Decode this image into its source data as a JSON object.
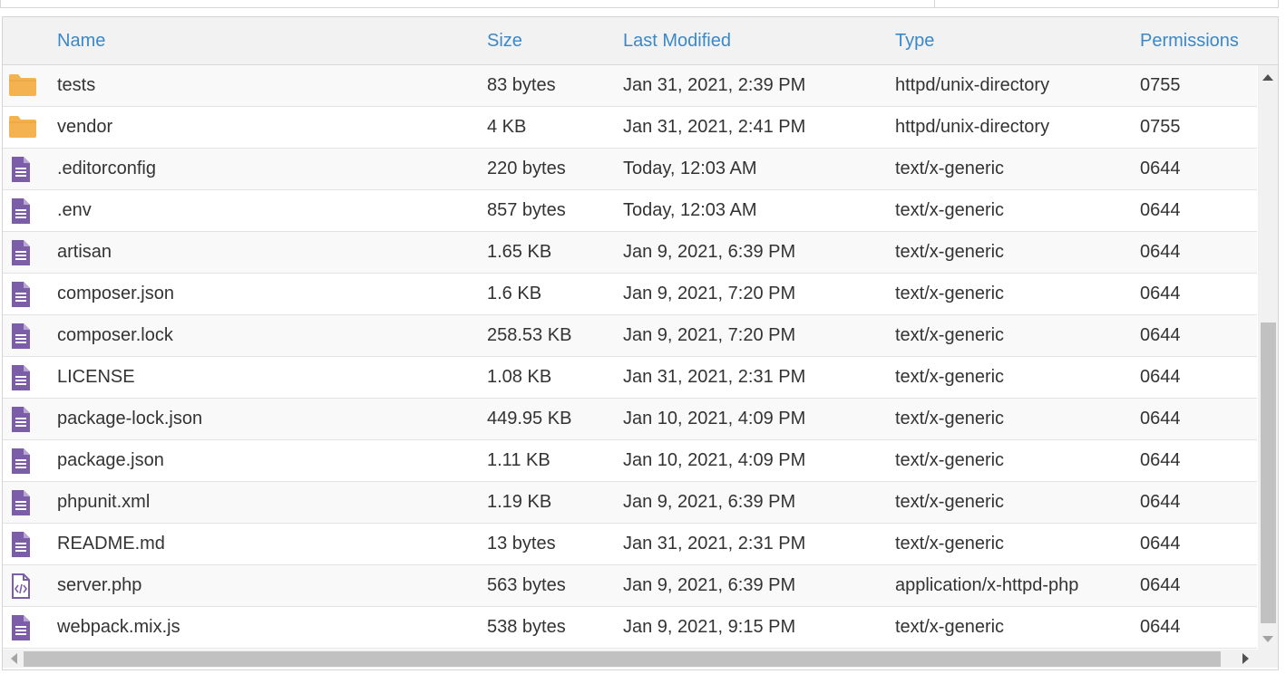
{
  "columns": {
    "name": "Name",
    "size": "Size",
    "modified": "Last Modified",
    "type": "Type",
    "permissions": "Permissions"
  },
  "colors": {
    "folder": "#f4b350",
    "file": "#7b5ea7",
    "header_text": "#3b88c8"
  },
  "rows": [
    {
      "icon": "folder-icon",
      "name": "tests",
      "size": "83 bytes",
      "modified": "Jan 31, 2021, 2:39 PM",
      "type": "httpd/unix-directory",
      "permissions": "0755"
    },
    {
      "icon": "folder-icon",
      "name": "vendor",
      "size": "4 KB",
      "modified": "Jan 31, 2021, 2:41 PM",
      "type": "httpd/unix-directory",
      "permissions": "0755"
    },
    {
      "icon": "file-text-icon",
      "name": ".editorconfig",
      "size": "220 bytes",
      "modified": "Today, 12:03 AM",
      "type": "text/x-generic",
      "permissions": "0644"
    },
    {
      "icon": "file-text-icon",
      "name": ".env",
      "size": "857 bytes",
      "modified": "Today, 12:03 AM",
      "type": "text/x-generic",
      "permissions": "0644"
    },
    {
      "icon": "file-text-icon",
      "name": "artisan",
      "size": "1.65 KB",
      "modified": "Jan 9, 2021, 6:39 PM",
      "type": "text/x-generic",
      "permissions": "0644"
    },
    {
      "icon": "file-text-icon",
      "name": "composer.json",
      "size": "1.6 KB",
      "modified": "Jan 9, 2021, 7:20 PM",
      "type": "text/x-generic",
      "permissions": "0644"
    },
    {
      "icon": "file-text-icon",
      "name": "composer.lock",
      "size": "258.53 KB",
      "modified": "Jan 9, 2021, 7:20 PM",
      "type": "text/x-generic",
      "permissions": "0644"
    },
    {
      "icon": "file-text-icon",
      "name": "LICENSE",
      "size": "1.08 KB",
      "modified": "Jan 31, 2021, 2:31 PM",
      "type": "text/x-generic",
      "permissions": "0644"
    },
    {
      "icon": "file-text-icon",
      "name": "package-lock.json",
      "size": "449.95 KB",
      "modified": "Jan 10, 2021, 4:09 PM",
      "type": "text/x-generic",
      "permissions": "0644"
    },
    {
      "icon": "file-text-icon",
      "name": "package.json",
      "size": "1.11 KB",
      "modified": "Jan 10, 2021, 4:09 PM",
      "type": "text/x-generic",
      "permissions": "0644"
    },
    {
      "icon": "file-text-icon",
      "name": "phpunit.xml",
      "size": "1.19 KB",
      "modified": "Jan 9, 2021, 6:39 PM",
      "type": "text/x-generic",
      "permissions": "0644"
    },
    {
      "icon": "file-text-icon",
      "name": "README.md",
      "size": "13 bytes",
      "modified": "Jan 31, 2021, 2:31 PM",
      "type": "text/x-generic",
      "permissions": "0644"
    },
    {
      "icon": "file-code-icon",
      "name": "server.php",
      "size": "563 bytes",
      "modified": "Jan 9, 2021, 6:39 PM",
      "type": "application/x-httpd-php",
      "permissions": "0644"
    },
    {
      "icon": "file-text-icon",
      "name": "webpack.mix.js",
      "size": "538 bytes",
      "modified": "Jan 9, 2021, 9:15 PM",
      "type": "text/x-generic",
      "permissions": "0644"
    }
  ]
}
